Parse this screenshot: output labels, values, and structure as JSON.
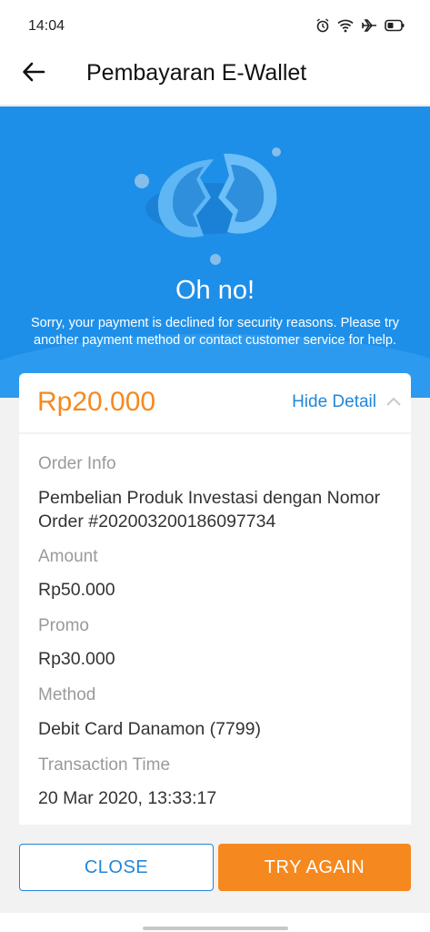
{
  "status_bar": {
    "time": "14:04"
  },
  "header": {
    "title": "Pembayaran E-Wallet"
  },
  "hero": {
    "title": "Oh no!",
    "message": "Sorry, your payment is declined for security reasons. Please try another payment method or contact customer service for help."
  },
  "summary": {
    "amount": "Rp20.000",
    "toggle_label": "Hide Detail"
  },
  "details": {
    "order_info_label": "Order Info",
    "order_info_value": "Pembelian Produk Investasi dengan Nomor Order #202003200186097734",
    "amount_label": "Amount",
    "amount_value": "Rp50.000",
    "promo_label": "Promo",
    "promo_value": "Rp30.000",
    "method_label": "Method",
    "method_value": "Debit Card Danamon (7799)",
    "time_label": "Transaction Time",
    "time_value": "20 Mar 2020, 13:33:17"
  },
  "actions": {
    "close_label": "CLOSE",
    "retry_label": "TRY AGAIN"
  },
  "colors": {
    "primary": "#1e8fe8",
    "accent": "#f5891f",
    "link": "#2286d9"
  }
}
